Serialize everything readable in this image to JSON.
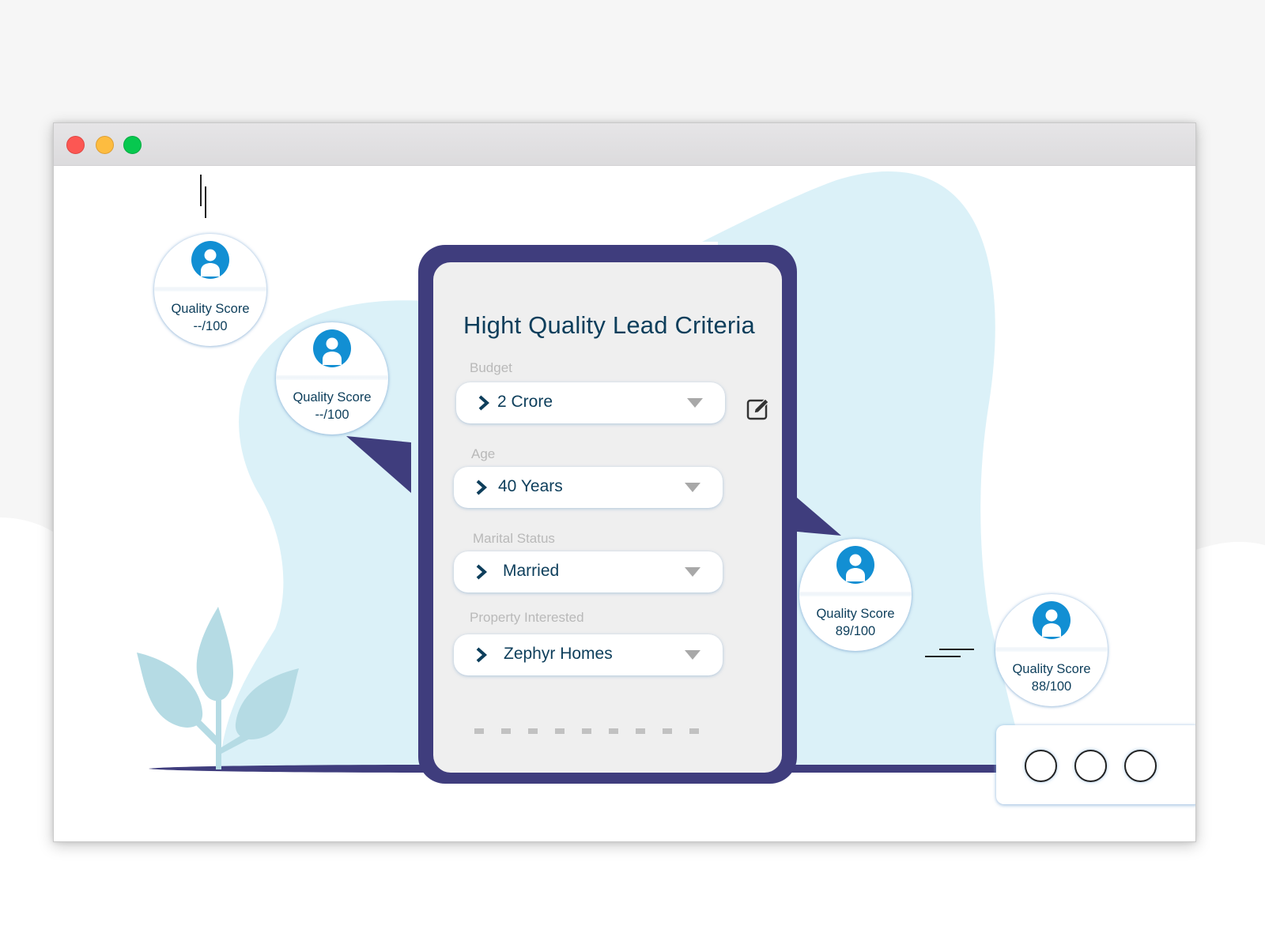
{
  "window": {
    "controls": [
      {
        "name": "close",
        "color": "#fc5753"
      },
      {
        "name": "minimize",
        "color": "#fdbc40"
      },
      {
        "name": "maximize",
        "color": "#07c84f"
      }
    ]
  },
  "colors": {
    "brand_purple": "#3f3d7d",
    "accent_blue": "#128fd3",
    "text_navy": "#0d3e5b",
    "blob_light_blue": "#dbf1f8",
    "plant_blue": "#b5dbe4"
  },
  "card": {
    "title": "Hight Quality Lead Criteria",
    "edit_icon": "edit-pencil-icon",
    "fields": [
      {
        "label": "Budget",
        "value": "2 Crore"
      },
      {
        "label": "Age",
        "value": "40 Years"
      },
      {
        "label": "Marital Status",
        "value": "Married"
      },
      {
        "label": "Property Interested",
        "value": "Zephyr Homes"
      }
    ],
    "pagination_dots": 9
  },
  "leads": [
    {
      "label": "Quality Score",
      "score": "--/100",
      "icon": "user-avatar-icon"
    },
    {
      "label": "Quality Score",
      "score": "--/100",
      "icon": "user-avatar-icon"
    },
    {
      "label": "Quality Score",
      "score": "89/100",
      "icon": "user-avatar-icon"
    },
    {
      "label": "Quality Score",
      "score": "88/100",
      "icon": "user-avatar-icon"
    }
  ],
  "option_panel": {
    "options": 3
  }
}
